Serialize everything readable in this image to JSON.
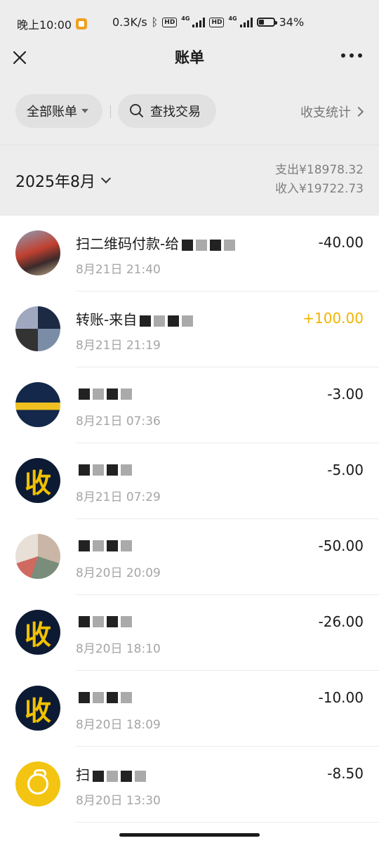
{
  "status_bar": {
    "time": "晚上10:00",
    "net_speed": "0.3K/s",
    "hd1": "HD",
    "net1": "4G",
    "hd2": "HD",
    "net2": "4G",
    "battery": "34%",
    "battery_level": 0.34
  },
  "header": {
    "title": "账单"
  },
  "filters": {
    "all_bills": "全部账单",
    "search": "查找交易",
    "stats": "收支统计"
  },
  "month": {
    "label": "2025年8月",
    "expense": "支出¥18978.32",
    "income": "收入¥19722.73"
  },
  "transactions": [
    {
      "title": "扫二维码付款-给",
      "time": "8月21日 21:40",
      "amount": "-40.00",
      "avatar": "photo-a"
    },
    {
      "title": "转账-来自",
      "time": "8月21日 21:19",
      "amount": "+100.00",
      "avatar": "photo-b"
    },
    {
      "title": "",
      "time": "8月21日 07:36",
      "amount": "-3.00",
      "avatar": "photo-c"
    },
    {
      "title": "",
      "time": "8月21日 07:29",
      "amount": "-5.00",
      "avatar": "shou",
      "avatar_text": "收"
    },
    {
      "title": "",
      "time": "8月20日 20:09",
      "amount": "-50.00",
      "avatar": "photo-d"
    },
    {
      "title": "",
      "time": "8月20日 18:10",
      "amount": "-26.00",
      "avatar": "shou",
      "avatar_text": "收"
    },
    {
      "title": "",
      "time": "8月20日 18:09",
      "amount": "-10.00",
      "avatar": "shou",
      "avatar_text": "收"
    },
    {
      "title": "扫",
      "time": "8月20日 13:30",
      "amount": "-8.50",
      "avatar": "pay"
    }
  ]
}
